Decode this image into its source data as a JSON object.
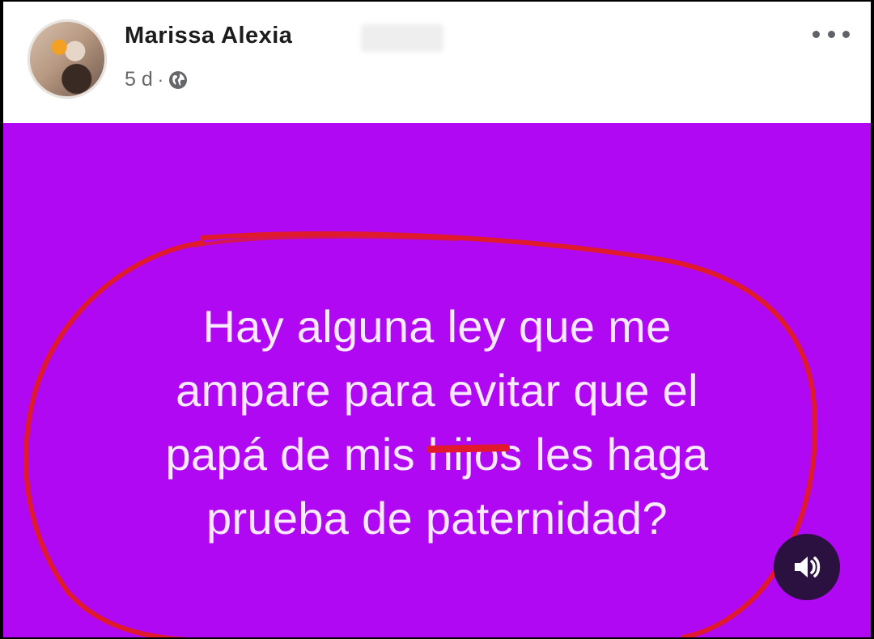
{
  "post": {
    "author": "Marissa Alexia",
    "time": "5 d",
    "separator": "·",
    "privacy_icon": "globe-icon",
    "menu_icon": "more-horizontal-icon",
    "background_color": "#b008f2",
    "text_lines": [
      "Hay alguna ley que me",
      "ampare para evitar que el",
      "papá de mis ",
      "hijos",
      "s les haga",
      "prueba de paternidad?"
    ],
    "struck_word": "hijo",
    "annotation_color": "#e01a2c"
  },
  "controls": {
    "sound_icon": "speaker-icon"
  }
}
